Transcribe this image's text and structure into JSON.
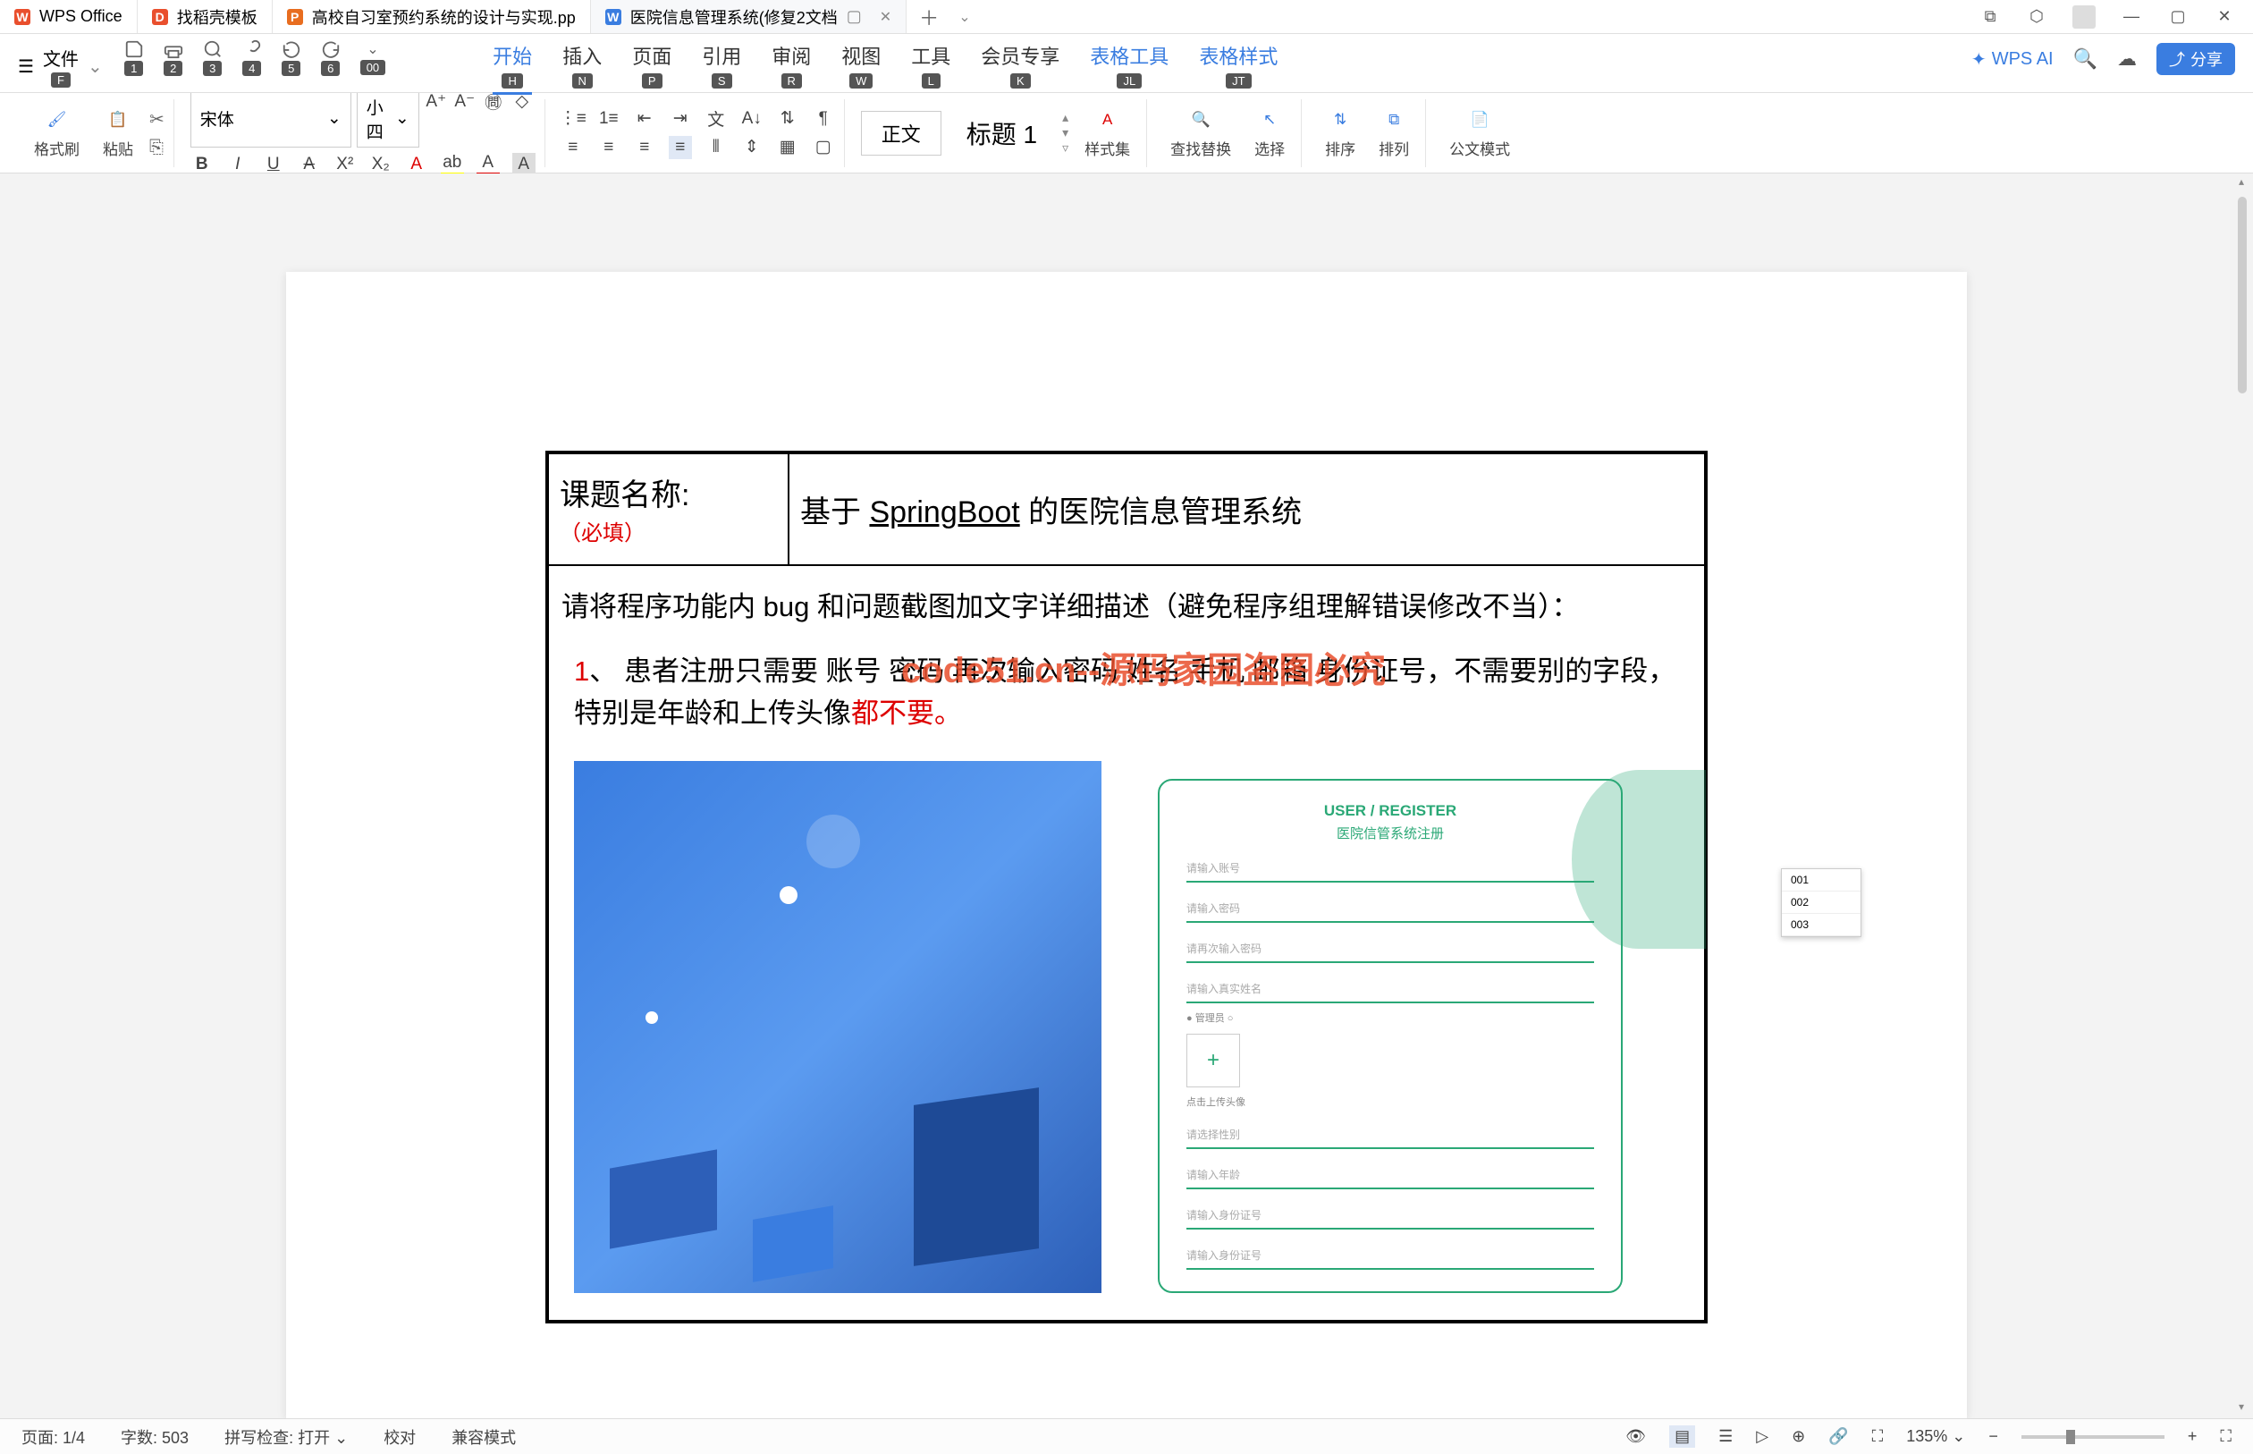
{
  "titlebar": {
    "app": "WPS Office",
    "tabs": [
      {
        "icon": "D",
        "label": "找稻壳模板"
      },
      {
        "icon": "P",
        "label": "高校自习室预约系统的设计与实现.pp"
      },
      {
        "icon": "W",
        "label": "医院信息管理系统(修复2文档",
        "active": true
      }
    ]
  },
  "filemenu": {
    "label": "文件",
    "hint": "F"
  },
  "qat": [
    {
      "hint": "1"
    },
    {
      "hint": "2"
    },
    {
      "hint": "3"
    },
    {
      "hint": "4"
    },
    {
      "hint": "5"
    },
    {
      "hint": "6"
    },
    {
      "hint": "00"
    }
  ],
  "menus": [
    {
      "label": "开始",
      "hint": "H",
      "active": true
    },
    {
      "label": "插入",
      "hint": "N"
    },
    {
      "label": "页面",
      "hint": "P"
    },
    {
      "label": "引用",
      "hint": "S"
    },
    {
      "label": "审阅",
      "hint": "R"
    },
    {
      "label": "视图",
      "hint": "W"
    },
    {
      "label": "工具",
      "hint": "L"
    },
    {
      "label": "会员专享",
      "hint": "K"
    },
    {
      "label": "表格工具",
      "hint": "JL"
    },
    {
      "label": "表格样式",
      "hint": "JT"
    }
  ],
  "ribbon": {
    "format_painter": "格式刷",
    "paste": "粘贴",
    "font_name": "宋体",
    "font_size": "小四",
    "style_body": "正文",
    "style_h1": "标题 1",
    "style_set": "样式集",
    "find_replace": "查找替换",
    "select": "选择",
    "sort": "排序",
    "arrange": "排列",
    "gov_mode": "公文模式"
  },
  "wpsai": "WPS AI",
  "share": "分享",
  "doc": {
    "label": "课题名称:",
    "required": "（必填）",
    "title_pre": "基于 ",
    "title_mid": "SpringBoot",
    "title_post": " 的医院信息管理系统",
    "instruction": "请将程序功能内 bug 和问题截图加文字详细描述（避免程序组理解错误修改不当）：",
    "item_num": "1",
    "item_sep": "、",
    "item1a": "患者注册只需要  账号  密码  再次输入密码 姓名 手机  邮箱  身份证号，不需要别的字段，特别是年龄和上传头像",
    "item1b": "都不要。",
    "watermark": "code51.cn--源码家园盗图必究"
  },
  "embed": {
    "title_en": "USER / REGISTER",
    "title_cn": "医院信管系统注册",
    "fields": [
      "请输入账号",
      "请输入密码",
      "请再次输入密码",
      "请输入真实姓名",
      "点击上传头像",
      "请选择性别",
      "请输入年龄",
      "请输入身份证号",
      "请输入身份证号"
    ],
    "dd": [
      "001",
      "002",
      "003"
    ],
    "radio": "管理员"
  },
  "status": {
    "page": "页面: 1/4",
    "words": "字数: 503",
    "spell": "拼写检查: 打开",
    "proof": "校对",
    "compat": "兼容模式",
    "zoom": "135%"
  }
}
